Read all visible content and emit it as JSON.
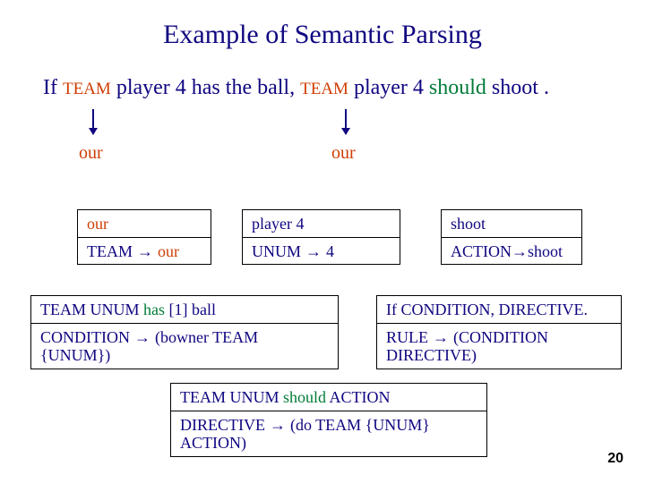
{
  "title": "Example of Semantic Parsing",
  "sentence": {
    "if": "If",
    "team": "TEAM",
    "player": "player",
    "four": "4",
    "has": "has",
    "the": "the",
    "ball": "ball,",
    "should": "should",
    "shoot": "shoot",
    "dot": "."
  },
  "labels": {
    "our": "our"
  },
  "boxA": {
    "top": "our",
    "bot_lhs": "TEAM",
    "arrow": " → ",
    "bot_rhs": "our"
  },
  "boxB": {
    "top": "player 4",
    "bot_lhs": "UNUM",
    "arrow": " → ",
    "bot_rhs": "4"
  },
  "boxC": {
    "top": "shoot",
    "bot_lhs": "ACTION",
    "arrow": "→",
    "bot_rhs": "shoot"
  },
  "boxD": {
    "top_pre": "TEAM UNUM ",
    "top_has": "has",
    "top_post": " [1] ball",
    "bot_lhs": "CONDITION",
    "arrow": " → ",
    "bot_rhs": "(bowner TEAM {UNUM})"
  },
  "boxE": {
    "top": "If CONDITION, DIRECTIVE.",
    "bot_lhs": "RULE",
    "arrow": " → ",
    "bot_rhs": "(CONDITION DIRECTIVE)"
  },
  "boxF": {
    "top_pre": "TEAM UNUM ",
    "top_should": "should",
    "top_post": " ACTION",
    "bot_lhs": "DIRECTIVE",
    "arrow": " → ",
    "bot_rhs": "(do TEAM {UNUM} ACTION)"
  },
  "pagenum": "20"
}
